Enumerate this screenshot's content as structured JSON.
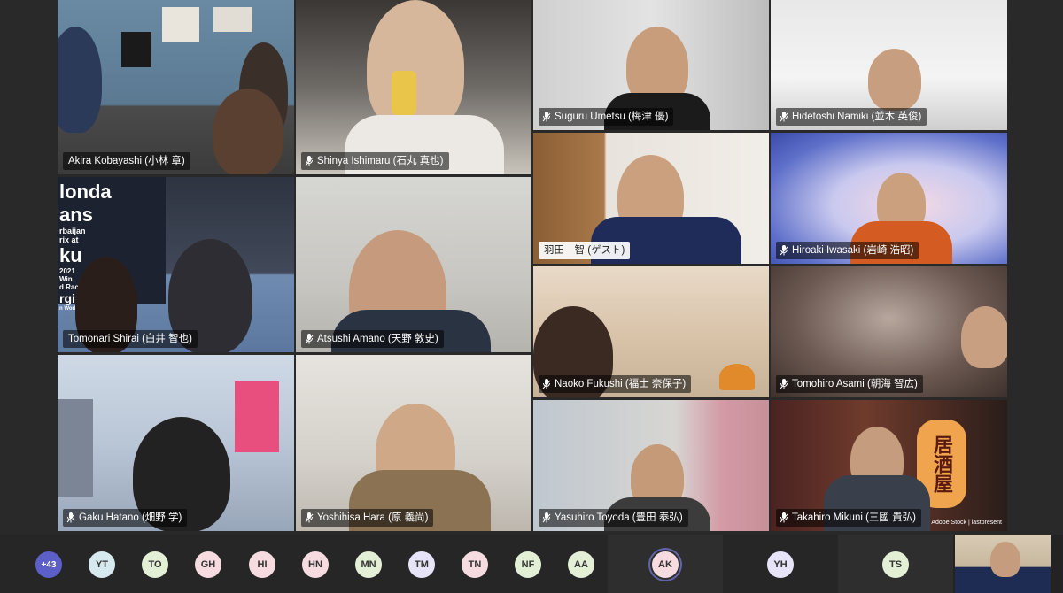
{
  "participants": [
    {
      "name": "Akira Kobayashi (小林 章)"
    },
    {
      "name": "Shinya Ishimaru (石丸 真也)"
    },
    {
      "name": "Suguru Umetsu (梅津 優)"
    },
    {
      "name": "Hidetoshi Namiki (並木 英俊)"
    },
    {
      "name": "Tomonari Shirai (白井 智也)"
    },
    {
      "name": "Atsushi Amano (天野 敦史)"
    },
    {
      "name": "羽田　智 (ゲスト)"
    },
    {
      "name": "Hiroaki Iwasaki (岩崎 浩昭)"
    },
    {
      "name": "Naoko Fukushi (福士 奈保子)"
    },
    {
      "name": "Tomohiro Asami (朝海 智広)"
    },
    {
      "name": "Gaku Hatano (畑野 学)"
    },
    {
      "name": "Yoshihisa Hara (原 義尚)"
    },
    {
      "name": "Yasuhiro Toyoda (豊田 泰弘)"
    },
    {
      "name": "Takahiro Mikuni (三國 貴弘)"
    }
  ],
  "background_text": {
    "honda_poster": [
      "londa",
      "ans",
      "rbaijan",
      "rix at",
      "ku",
      "2021",
      "Win",
      "d Racing",
      "rgio P",
      "n World Chan"
    ],
    "lantern": "居酒屋",
    "stock_credit": "Adobe Stock | lastpresent"
  },
  "roster": {
    "overflow": "+43",
    "avatars": [
      {
        "initials": "YT",
        "color": "#d6e9ef"
      },
      {
        "initials": "TO",
        "color": "#e3f0d6"
      },
      {
        "initials": "GH",
        "color": "#f6dbe0"
      },
      {
        "initials": "HI",
        "color": "#f6dbe0"
      },
      {
        "initials": "HN",
        "color": "#f6dbe0"
      },
      {
        "initials": "MN",
        "color": "#e3f0d6"
      },
      {
        "initials": "TM",
        "color": "#e6e4f6"
      },
      {
        "initials": "TN",
        "color": "#f6dbe0"
      },
      {
        "initials": "NF",
        "color": "#e3f0d6"
      },
      {
        "initials": "AA",
        "color": "#e3f0d6"
      },
      {
        "initials": "AK",
        "color": "#f6dbe0"
      },
      {
        "initials": "YH",
        "color": "#e6e4f6"
      },
      {
        "initials": "TS",
        "color": "#e3f0d6"
      }
    ]
  },
  "colors": {
    "accent": "#6264a7",
    "tile_border": "#2b2b2b"
  }
}
